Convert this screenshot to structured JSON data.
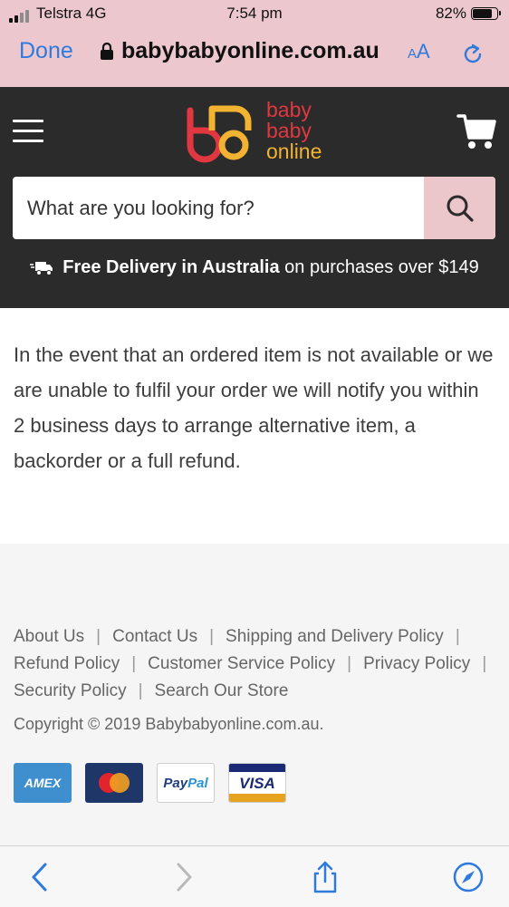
{
  "status_bar": {
    "carrier": "Telstra 4G",
    "time": "7:54 pm",
    "battery": "82%",
    "battery_level": 0.82
  },
  "browser": {
    "done_label": "Done",
    "url": "babybabyonline.com.au",
    "text_size_label_small": "A",
    "text_size_label_large": "A",
    "icons": [
      "lock-icon",
      "reload-icon",
      "back-icon",
      "forward-icon",
      "share-icon",
      "compass-icon"
    ]
  },
  "header": {
    "logo": {
      "line1": "baby",
      "line2": "baby",
      "line3": "online"
    },
    "search": {
      "placeholder": "What are you looking for?"
    },
    "promo": {
      "bold": "Free Delivery in Australia",
      "rest": "on purchases over $149"
    },
    "colors": {
      "background": "#2b2b2b",
      "accent": "#ebc6cb",
      "logo_red": "#e03840",
      "logo_yellow": "#f2b332"
    }
  },
  "main": {
    "paragraph": "In the event that an ordered item is not available or we are unable to fulfil your order we will notify you within 2 business days to arrange alternative item, a backorder or a full refund."
  },
  "footer": {
    "links": [
      "About Us",
      "Contact Us",
      "Shipping and Delivery Policy",
      "Refund Policy",
      "Customer Service Policy",
      "Privacy Policy",
      "Security Policy",
      "Search Our Store"
    ],
    "separator": "|",
    "copyright": "Copyright © 2019 Babybabyonline.com.au.",
    "payments": {
      "amex": "AMEX",
      "paypal_1": "Pay",
      "paypal_2": "Pal",
      "visa": "VISA"
    }
  }
}
